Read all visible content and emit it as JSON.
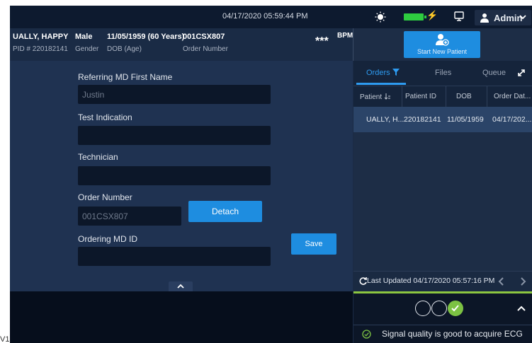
{
  "header": {
    "datetime": "04/17/2020 05:59:44 PM",
    "user_label": "Admin",
    "colors": {
      "battery": "#2ecc40",
      "accent": "#1e8de0"
    }
  },
  "patient": {
    "name": "UALLY, HAPPY",
    "pid": "PID # 220182141",
    "gender_value": "Male",
    "gender_label": "Gender",
    "dob_value": "11/05/1959 (60 Years)",
    "dob_label": "DOB (Age)",
    "order_value": "001CSX807",
    "order_label": "Order Number",
    "bpm_value": "***",
    "bpm_unit": "BPM"
  },
  "form": {
    "referring_md_label": "Referring MD First Name",
    "referring_md_value": "Justin",
    "test_indication_label": "Test Indication",
    "test_indication_value": "",
    "technician_label": "Technician",
    "technician_value": "",
    "order_number_label": "Order Number",
    "order_number_value": "001CSX807",
    "detach_label": "Detach",
    "ordering_md_label": "Ordering MD ID",
    "ordering_md_value": "",
    "save_label": "Save"
  },
  "right_panel": {
    "new_patient_label": "Start New Patient",
    "tabs": [
      {
        "label": "Orders",
        "active": true
      },
      {
        "label": "Files",
        "active": false
      },
      {
        "label": "Queue",
        "active": false
      }
    ],
    "columns": [
      "Patient",
      "Patient ID",
      "DOB",
      "Order Dat..."
    ],
    "rows": [
      {
        "patient": "UALLY, H...",
        "patient_id": "220182141",
        "dob": "11/05/1959",
        "order_date": "04/17/202..."
      }
    ],
    "last_updated": "Last Updated 04/17/2020 05:57:16 PM",
    "signal_text": "Signal quality is good to acquire ECG",
    "steps": [
      {
        "state": "pending"
      },
      {
        "state": "pending"
      },
      {
        "state": "done"
      }
    ]
  },
  "footer": {
    "version": "V1"
  },
  "icons": [
    "sun-icon",
    "battery-icon",
    "charging-bolt-icon",
    "monitor-icon",
    "user-icon",
    "chevron-down-icon",
    "add-patient-icon",
    "filter-icon",
    "expand-icon",
    "sort-icon",
    "refresh-icon",
    "chevron-left-icon",
    "chevron-right-icon",
    "chevron-up-icon",
    "check-icon",
    "check-circle-icon"
  ]
}
